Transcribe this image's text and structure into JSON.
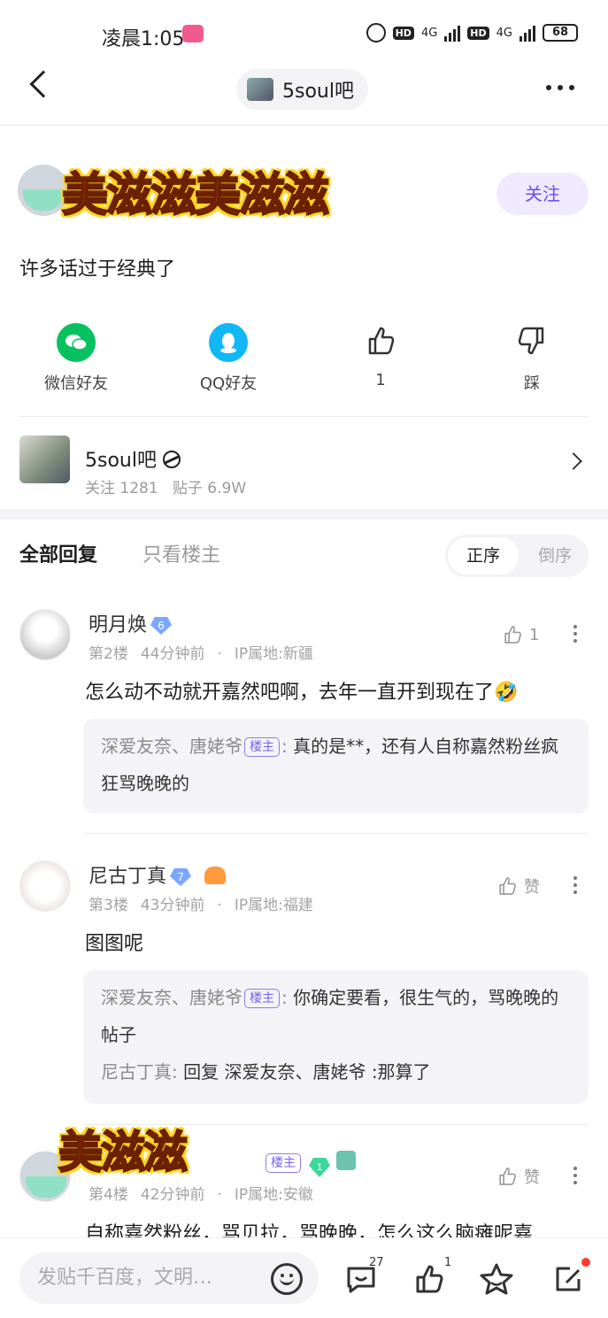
{
  "status_bar": {
    "time": "凌晨1:05",
    "battery": "68",
    "network_1": "4G",
    "network_2": "4G"
  },
  "nav": {
    "forum_title": "5soul吧"
  },
  "post": {
    "sticker_text": "美滋滋美滋滋",
    "follow_label": "关注",
    "text": "许多话过于经典了"
  },
  "share": {
    "wechat": "微信好友",
    "qq": "QQ好友",
    "like_count": "1",
    "dislike": "踩"
  },
  "forum_card": {
    "name": "5soul吧",
    "stats": "关注 1281   贴子 6.9W"
  },
  "tabs": {
    "all": "全部回复",
    "owner_only": "只看楼主",
    "order_asc": "正序",
    "order_desc": "倒序"
  },
  "comments": [
    {
      "name": "明月焕",
      "level": "6",
      "floor": "第2楼",
      "time": "44分钟前",
      "ip": "IP属地:新疆",
      "likes": "1",
      "body": "怎么动不动就开嘉然吧啊，去年一直开到现在了🤣",
      "replies": [
        {
          "name": "深爱友奈、唐姥爷",
          "owner_tag": "楼主",
          "text": "真的是**，还有人自称嘉然粉丝疯狂骂晚晚的"
        }
      ]
    },
    {
      "name": "尼古丁真",
      "level": "7",
      "floor": "第3楼",
      "time": "43分钟前",
      "ip": "IP属地:福建",
      "likes": "赞",
      "body": "图图呢",
      "replies": [
        {
          "name": "深爱友奈、唐姥爷",
          "owner_tag": "楼主",
          "text": "你确定要看，很生气的，骂晚晚的帖子"
        },
        {
          "name": "尼古丁真",
          "text": "回复 深爱友奈、唐姥爷 :那算了"
        }
      ]
    },
    {
      "name_sticker": "美滋滋",
      "owner_tag": "楼主",
      "level": "1",
      "floor": "第4楼",
      "time": "42分钟前",
      "ip": "IP属地:安徽",
      "likes": "赞",
      "body": "自称嘉然粉丝，骂贝拉，骂晚晚，怎么这么脑瘫呢嘉"
    }
  ],
  "bottom_bar": {
    "input_placeholder": "发贴千百度，文明…",
    "comment_count": "27",
    "like_count": "1"
  }
}
